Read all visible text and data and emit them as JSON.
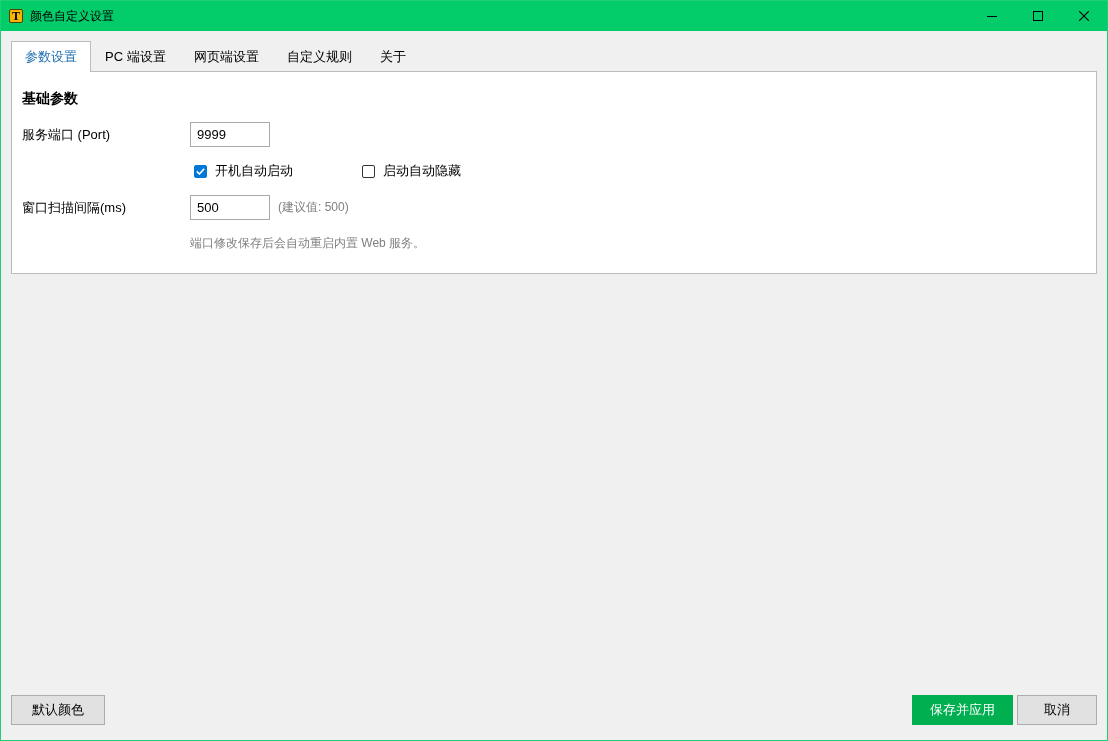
{
  "window": {
    "title": "颜色自定义设置",
    "icon_letter": "T"
  },
  "tabs": [
    {
      "label": "参数设置",
      "selected": true
    },
    {
      "label": "PC 端设置",
      "selected": false
    },
    {
      "label": "网页端设置",
      "selected": false
    },
    {
      "label": "自定义规则",
      "selected": false
    },
    {
      "label": "关于",
      "selected": false
    }
  ],
  "section": {
    "heading": "基础参数",
    "rows": [
      {
        "kind": "input",
        "label": "服务端口 (Port)",
        "value": "9999"
      },
      {
        "kind": "checkboxes",
        "options": [
          {
            "label": "开机自动启动",
            "checked": true
          },
          {
            "label": "启动自动隐藏",
            "checked": false
          }
        ]
      },
      {
        "kind": "input",
        "label": "窗口扫描间隔(ms)",
        "value": "500",
        "hint": "(建议值: 500)"
      },
      {
        "kind": "note",
        "text": "端口修改保存后会自动重启内置 Web 服务。"
      }
    ]
  },
  "footer": {
    "left_buttons": [
      {
        "label": "默认颜色",
        "kind": "secondary"
      }
    ],
    "right_buttons": [
      {
        "label": "保存并应用",
        "kind": "primary"
      },
      {
        "label": "取消",
        "kind": "secondary"
      }
    ]
  }
}
